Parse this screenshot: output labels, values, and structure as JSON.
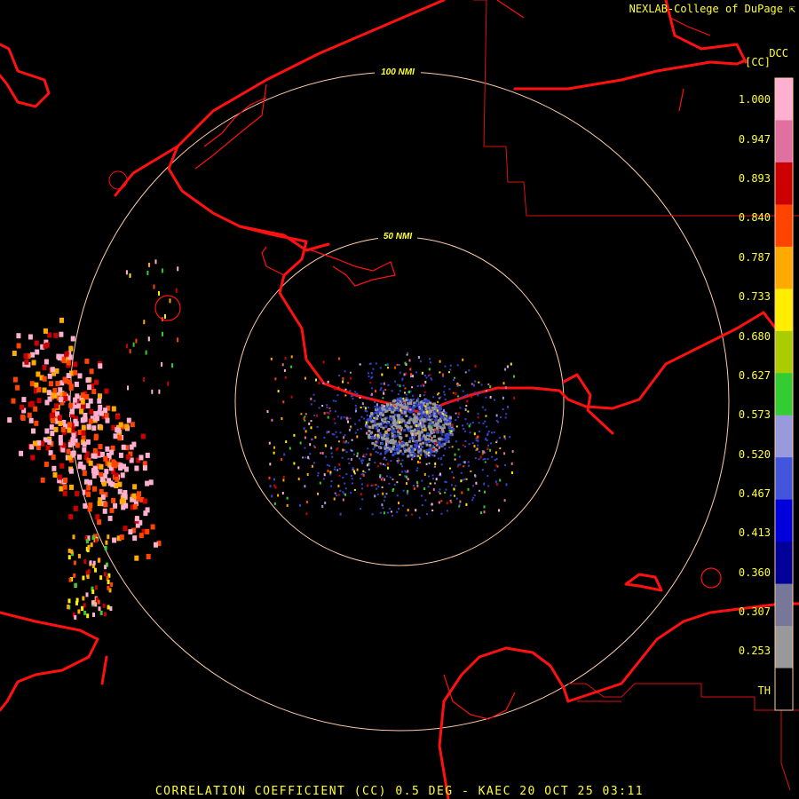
{
  "header": {
    "credit": "NEXLAB-College of DuPage",
    "credit_icon": "arrow-corner-icon",
    "product_code": "DCC",
    "unit": "[CC]"
  },
  "footer": {
    "caption": "CORRELATION COEFFICIENT (CC) 0.5 DEG - KAEC 20 OCT 25 03:11"
  },
  "range_rings": [
    {
      "label": "100 NMI"
    },
    {
      "label": "50 NMI"
    }
  ],
  "color_scale": {
    "labels": [
      "1.000",
      "0.947",
      "0.893",
      "0.840",
      "0.787",
      "0.733",
      "0.680",
      "0.627",
      "0.573",
      "0.520",
      "0.467",
      "0.413",
      "0.360",
      "0.307",
      "0.253",
      "TH"
    ],
    "colors": [
      "#ffb0d0",
      "#e070a0",
      "#cc0000",
      "#ff4400",
      "#ffaa00",
      "#ffee00",
      "#aacc00",
      "#33cc33",
      "#9999dd",
      "#4455dd",
      "#0000dd",
      "#000099",
      "#777799",
      "#999999",
      "#000000"
    ]
  },
  "colors": {
    "coastline": "#ff1111",
    "ring": "#ffccaa",
    "text": "#ffff33",
    "clutter": "#999999",
    "near_echo": "#3344cc"
  }
}
